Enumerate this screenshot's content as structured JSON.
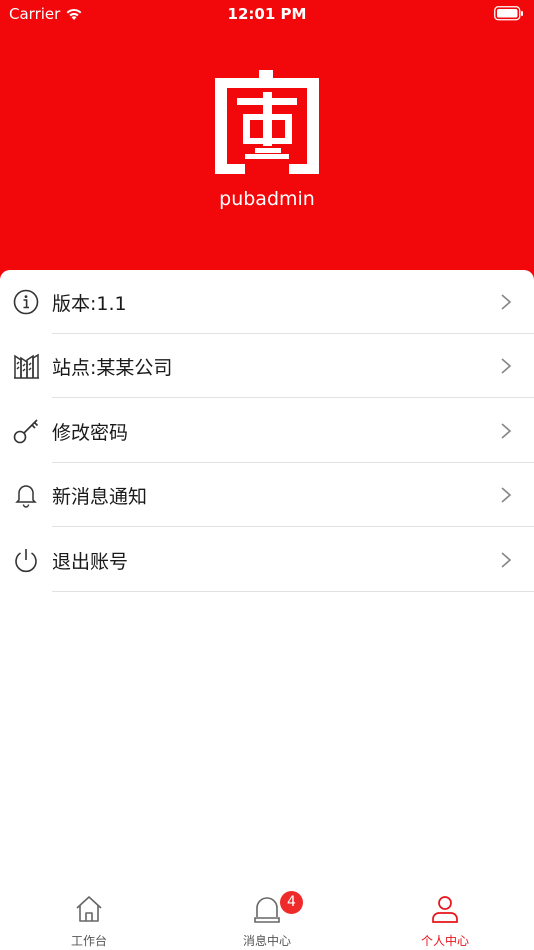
{
  "status_bar": {
    "carrier": "Carrier",
    "time": "12:01 PM"
  },
  "profile": {
    "username": "pubadmin"
  },
  "menu": [
    {
      "label": "版本:1.1",
      "icon": "info-icon"
    },
    {
      "label": "站点:某某公司",
      "icon": "building-icon"
    },
    {
      "label": "修改密码",
      "icon": "key-icon"
    },
    {
      "label": "新消息通知",
      "icon": "bell-icon"
    },
    {
      "label": "退出账号",
      "icon": "power-icon"
    }
  ],
  "tabbar": {
    "items": [
      {
        "label": "工作台",
        "icon": "home-icon"
      },
      {
        "label": "消息中心",
        "icon": "alarm-icon",
        "badge": "4"
      },
      {
        "label": "个人中心",
        "icon": "person-icon",
        "active": true
      }
    ]
  },
  "colors": {
    "brand": "#f2070b",
    "active_tab": "#e8141a",
    "badge": "#ef2a2a"
  }
}
